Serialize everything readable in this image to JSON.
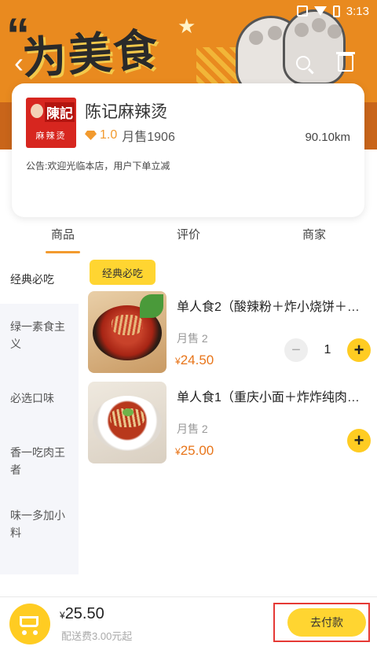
{
  "status_bar": {
    "time": "3:13"
  },
  "banner": {
    "quote_mark": "“",
    "slogan": "为美食"
  },
  "store": {
    "logo_brand": "陳記",
    "logo_sub": "麻辣烫",
    "name": "陈记麻辣烫",
    "rating": "1.0",
    "monthly_sales": "月售1906",
    "distance": "90.10km",
    "notice": "公告:欢迎光临本店，用户下单立减"
  },
  "tabs": [
    {
      "label": "商品",
      "active": true
    },
    {
      "label": "评价",
      "active": false
    },
    {
      "label": "商家",
      "active": false
    }
  ],
  "sidebar": {
    "items": [
      {
        "label": "经典必吃",
        "active": true
      },
      {
        "label": "绿一素食主义",
        "active": false
      },
      {
        "label": "必选口味",
        "active": false
      },
      {
        "label": "香一吃肉王者",
        "active": false
      },
      {
        "label": "味一多加小料",
        "active": false
      }
    ]
  },
  "category_pill": "经典必吃",
  "products": [
    {
      "name": "单人食2（酸辣粉＋炸小烧饼＋…",
      "sales": "月售 2",
      "currency": "¥",
      "price": "24.50",
      "qty": "1"
    },
    {
      "name": "单人食1（重庆小面＋炸炸纯肉…",
      "sales": "月售 2",
      "currency": "¥",
      "price": "25.00"
    }
  ],
  "bottom_bar": {
    "currency": "¥",
    "total": "25.50",
    "delivery_fee": "配送费3.00元起",
    "pay_label": "去付款"
  },
  "colors": {
    "accent": "#ffd531",
    "price": "#e8751a",
    "highlight": "#e53935"
  }
}
